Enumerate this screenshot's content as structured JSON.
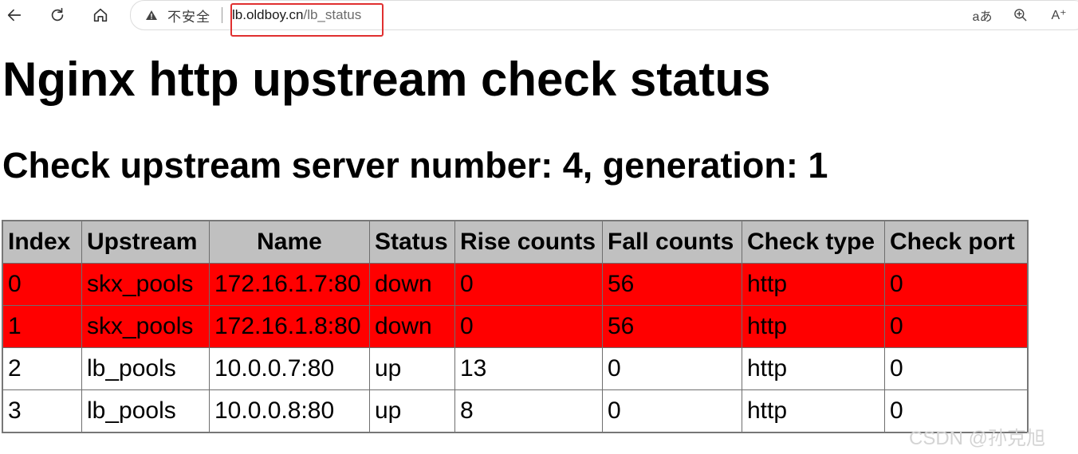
{
  "browser": {
    "security_label": "不安全",
    "url_host": "lb.oldboy.cn",
    "url_path": "/lb_status",
    "read_aloud_label": "aあ",
    "text_size_label": "A⁺"
  },
  "page": {
    "title": "Nginx http upstream check status",
    "subtitle": "Check upstream server number: 4, generation: 1"
  },
  "table": {
    "headers": [
      "Index",
      "Upstream",
      "Name",
      "Status",
      "Rise counts",
      "Fall counts",
      "Check type",
      "Check port"
    ],
    "rows": [
      {
        "index": "0",
        "upstream": "skx_pools",
        "name": "172.16.1.7:80",
        "status": "down",
        "rise": "0",
        "fall": "56",
        "type": "http",
        "port": "0"
      },
      {
        "index": "1",
        "upstream": "skx_pools",
        "name": "172.16.1.8:80",
        "status": "down",
        "rise": "0",
        "fall": "56",
        "type": "http",
        "port": "0"
      },
      {
        "index": "2",
        "upstream": "lb_pools",
        "name": "10.0.0.7:80",
        "status": "up",
        "rise": "13",
        "fall": "0",
        "type": "http",
        "port": "0"
      },
      {
        "index": "3",
        "upstream": "lb_pools",
        "name": "10.0.0.8:80",
        "status": "up",
        "rise": "8",
        "fall": "0",
        "type": "http",
        "port": "0"
      }
    ]
  },
  "watermark": "CSDN @孙克旭",
  "colors": {
    "down_row": "#ff0000",
    "header_bg": "#c0c0c0",
    "highlight_box": "#e03030"
  }
}
